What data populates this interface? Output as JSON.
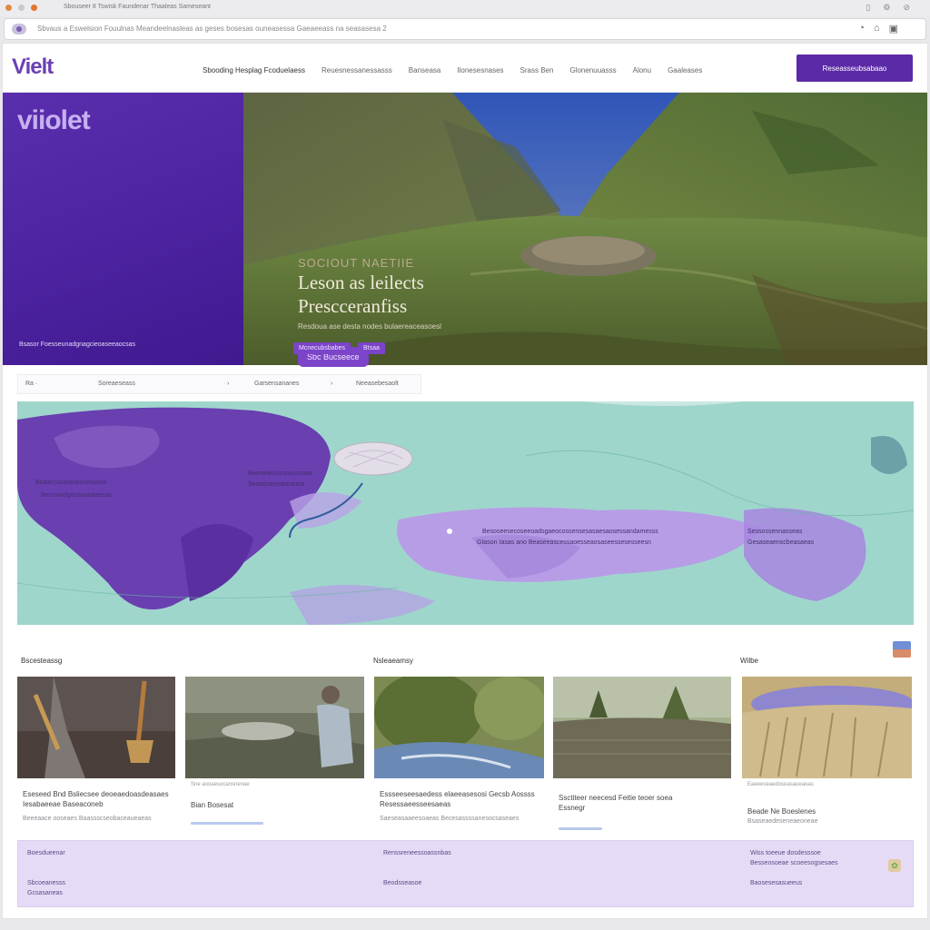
{
  "browser": {
    "tab_title": "Sbouseer 8 Tswisk Faundenar Thaaleas Sameseant",
    "address": "Sbvaus a Eswelsion Fouulnas Meandeelnasleas as geses bosesas ouneasessa Gaeaeeass na seasasesa 2"
  },
  "nav": {
    "brand": "Vielt",
    "links": [
      "Sbooding Hesplag Fcoduelaess",
      "Reuesnessanessasss",
      "Banseasa",
      "Ilonesesnases",
      "Srass Ben",
      "Glonenuuasss",
      "Alonu",
      "Gaaleases"
    ],
    "cta": "Reseasseubsabaao"
  },
  "hero": {
    "side_logo": "viiolet",
    "side_footer": "Bsasor  Foesseunadgnagcieoaseeaocsas",
    "kicker": "SOCIOUT NAETIIE",
    "title_line1": "Leson as leilects",
    "title_line2": "Prescceranfiss",
    "subtitle": "Resdoua ase desta nodes bulaereaceasoesl",
    "button": "Sbc Bucseece",
    "tags": [
      "Mcnecubsbabes",
      "Btsaa"
    ]
  },
  "map_bar": {
    "c1": "Ra ·",
    "c2": "Soreaeseass",
    "c3": "Garsensananes",
    "c4": "Neeasebesaolt"
  },
  "map": {
    "label_a1": "Bcaaccucasssensesuess",
    "label_a2": "Beucwodgecasoeaaesas",
    "label_b1": "Beoneaiousnnassonae",
    "label_b2": "Seasdoeoeaseanoa",
    "label_c1": "Besoseesecoseeoadsgaeocossensesasaesaosessandamesss",
    "label_c2": "Gtason Iasas ano Beaseeascessaoesseaosaseessesesseesn",
    "label_d1": "Sessossennasseas",
    "label_d2": "Gesaseaenscbeasaeas"
  },
  "gallery": {
    "sections": [
      "Bscesteassg",
      "Nsleaeamsy",
      "Wilbe"
    ],
    "cards": [
      {
        "meta": "",
        "title": "Eseseed Bnd Bsliecsee deoeaedoasdeasaes Iesabaeeae Baseaconeb",
        "line": "Beeeaace ooseaes   Baassscseobaceaueaeas"
      },
      {
        "meta": "Sne aooaesocansnenae",
        "title": "Bian Bosesat",
        "line": ""
      },
      {
        "meta": "",
        "title": "Essseeseesaedess elaeeasesosi Gecsb Aossss Resessaeesseesaeas",
        "line": "Saeseasaaeesoaeas   Becesassssanesocsaseaes"
      },
      {
        "meta": "",
        "title": "Ssctiteer neecesd Feitie teoer soea Essnegr",
        "line": ""
      },
      {
        "meta": "Eaeeeseaedoseasaueaoas",
        "title": "Beade Ne Boeslenes",
        "line": "Bsaseaedeseneaeoneae"
      }
    ]
  },
  "footer": {
    "col1_a": "Boesdueenar",
    "col1_b1": "Sbcoeanesss",
    "col1_b2": "Gcsasaneas",
    "col2_a": "Renssreneessoassnbas",
    "col2_b": "Beodsseasoe",
    "col3_a1": "Wiss toeeue dosdesssoe",
    "col3_a2": "Besseosoeae scoeesogsesaes",
    "col3_b": "Baosesesasueeus"
  },
  "colors": {
    "brand": "#6c3fb4",
    "cta": "#5b2aa6",
    "hero_side": "#4c22a0",
    "map_sea": "#9fd6cc",
    "map_land_violet": "#6a3fb0",
    "footer": "#e6dbf7"
  }
}
